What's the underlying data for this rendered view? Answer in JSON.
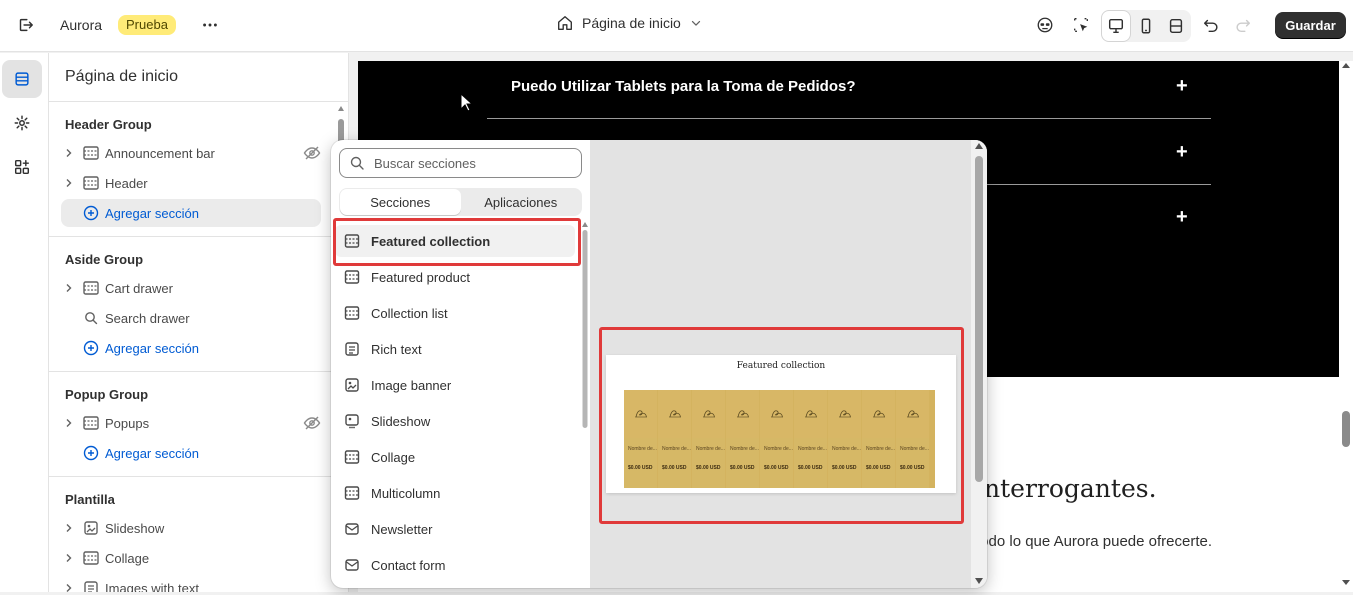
{
  "topbar": {
    "store_name": "Aurora",
    "badge": "Prueba",
    "page_selector": "Página de inicio",
    "save_label": "Guardar"
  },
  "sidebar": {
    "title": "Página de inicio",
    "groups": [
      {
        "title": "Header Group",
        "items": [
          {
            "label": "Announcement bar",
            "hidden": true
          },
          {
            "label": "Header",
            "hidden": false
          }
        ],
        "add_label": "Agregar sección"
      },
      {
        "title": "Aside Group",
        "items": [
          {
            "label": "Cart drawer",
            "hidden": false
          },
          {
            "label": "Search drawer",
            "hidden": false
          }
        ],
        "add_label": "Agregar sección"
      },
      {
        "title": "Popup Group",
        "items": [
          {
            "label": "Popups",
            "hidden": true
          }
        ],
        "add_label": "Agregar sección"
      },
      {
        "title": "Plantilla",
        "items": [
          {
            "label": "Slideshow"
          },
          {
            "label": "Collage"
          },
          {
            "label": "Images with text"
          }
        ]
      }
    ]
  },
  "picker": {
    "search_placeholder": "Buscar secciones",
    "tabs": [
      "Secciones",
      "Aplicaciones"
    ],
    "sections": [
      "Featured collection",
      "Featured product",
      "Collection list",
      "Rich text",
      "Image banner",
      "Slideshow",
      "Collage",
      "Multicolumn",
      "Newsletter",
      "Contact form"
    ],
    "selected": "Featured collection",
    "preview_title": "Featured collection",
    "product_name": "Nombre de...",
    "product_price": "$0.00 USD"
  },
  "preview": {
    "faq_question": "Puedo Utilizar Tablets para la Toma de Pedidos?",
    "heading_fragment": "nterrogantes.",
    "sub_fragment": "todo lo que Aurora puede ofrecerte."
  },
  "colors": {
    "accent": "#005bd3",
    "highlight": "#e03a3a",
    "badge_bg": "#ffeb78",
    "save_bg": "#303030",
    "product_tile": "#d6b866"
  }
}
